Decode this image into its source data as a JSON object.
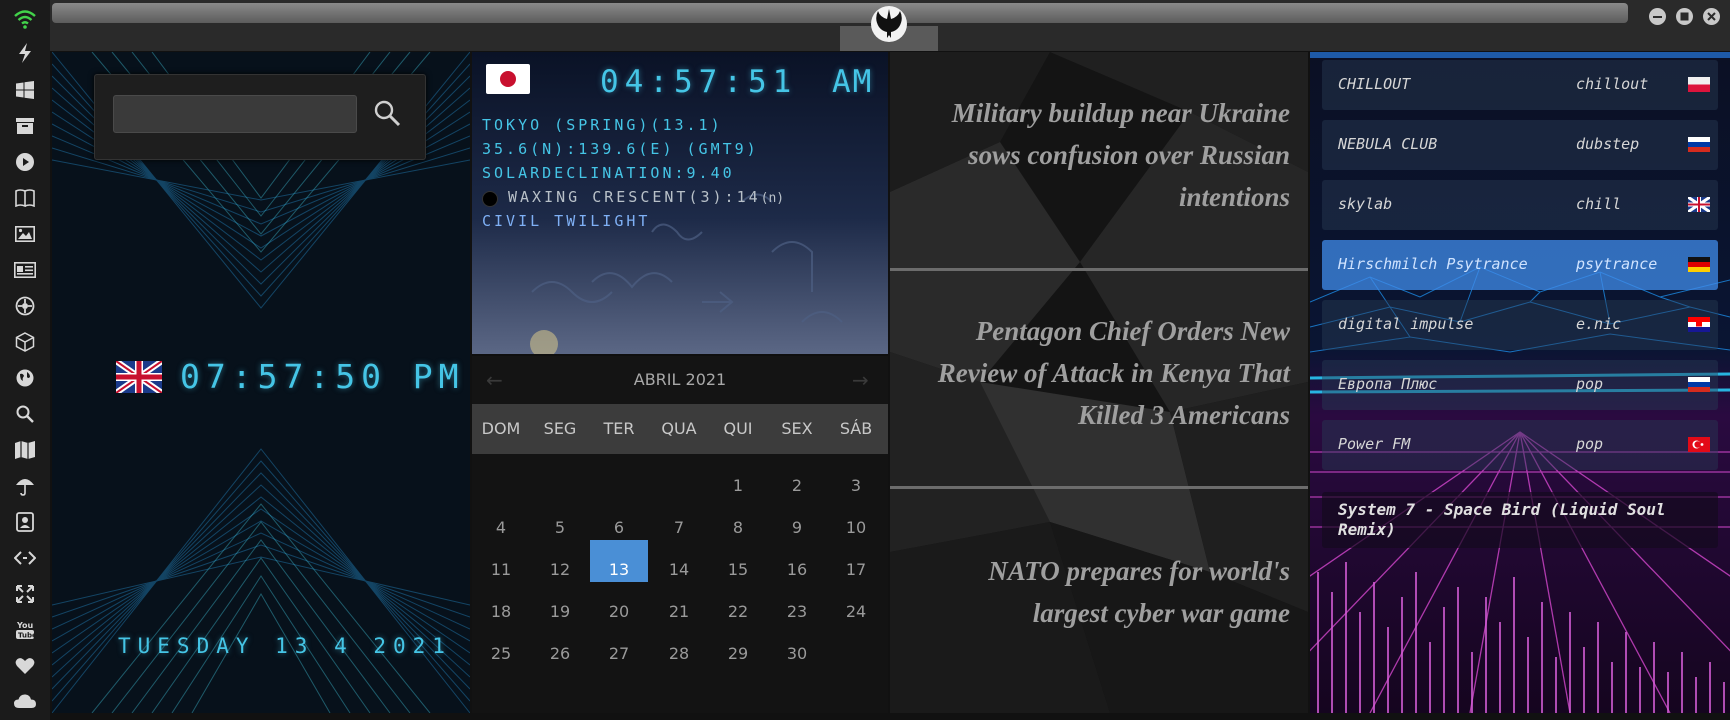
{
  "sidebar": {
    "icons": [
      "wifi-icon",
      "bolt-icon",
      "windows-icon",
      "archive-icon",
      "play-icon",
      "book-icon",
      "image-icon",
      "news-icon",
      "settings-icon",
      "cube-icon",
      "globe-icon",
      "search-icon",
      "map-icon",
      "umbrella-icon",
      "contacts-icon",
      "code-icon",
      "fullscreen-icon",
      "youtube-icon",
      "heart-icon",
      "cloud-icon"
    ]
  },
  "window": {
    "controls": [
      "minimize",
      "maximize",
      "close"
    ]
  },
  "clock": {
    "search_value": "",
    "time": "07:57:50 PM",
    "date": "TUESDAY 13 4 2021"
  },
  "astro": {
    "time": "04:57:51",
    "ampm": "AM",
    "location": "TOKYO (SPRING)(13.1)",
    "coords": "35.6(N):139.6(E) (GMT9)",
    "declination": "SOLARDECLINATION:9.40",
    "moon_prefix": "WAXING CRESCENT(3):14",
    "moon_suffix": "(n)",
    "twilight": "CIVIL TWILIGHT"
  },
  "calendar": {
    "month": "ABRIL 2021",
    "prev": "←",
    "next": "→",
    "weekdays": [
      "DOM",
      "SEG",
      "TER",
      "QUA",
      "QUI",
      "SEX",
      "SÁB"
    ],
    "weeks": [
      [
        "",
        "",
        "",
        "",
        "1",
        "2",
        "3"
      ],
      [
        "4",
        "5",
        "6",
        "7",
        "8",
        "9",
        "10"
      ],
      [
        "11",
        "12",
        "13",
        "14",
        "15",
        "16",
        "17"
      ],
      [
        "18",
        "19",
        "20",
        "21",
        "22",
        "23",
        "24"
      ],
      [
        "25",
        "26",
        "27",
        "28",
        "29",
        "30",
        ""
      ]
    ],
    "selected": "13"
  },
  "news": [
    {
      "line1": "Military buildup near Ukraine",
      "line2": "sows confusion over Russian",
      "line3": "intentions"
    },
    {
      "line1": "Pentagon Chief Orders New",
      "line2": "Review of Attack in Kenya That",
      "line3": "Killed 3 Americans"
    },
    {
      "line1": "NATO prepares for world's",
      "line2": "largest cyber war game"
    }
  ],
  "radio": {
    "stations": [
      {
        "name": "CHILLOUT",
        "genre": "chillout",
        "flag": "pl"
      },
      {
        "name": "NEBULA CLUB",
        "genre": "dubstep",
        "flag": "ru"
      },
      {
        "name": "skylab",
        "genre": "chill",
        "flag": "uk"
      },
      {
        "name": "Hirschmilch Psytrance",
        "genre": "psytrance",
        "flag": "de"
      },
      {
        "name": "digital impulse",
        "genre": "e.nic",
        "flag": "hr"
      },
      {
        "name": "Европа Плюс",
        "genre": "pop",
        "flag": "ru"
      },
      {
        "name": "Power FM",
        "genre": "pop",
        "flag": "tr"
      }
    ],
    "now_playing_line1": "System 7 - Space Bird (Liquid Soul",
    "now_playing_line2": "Remix)"
  },
  "colors": {
    "lcd": "#45c5e6",
    "accent": "#4a8fd6",
    "neon_pink": "#e04bd8",
    "neon_blue": "#2ad2ff"
  }
}
